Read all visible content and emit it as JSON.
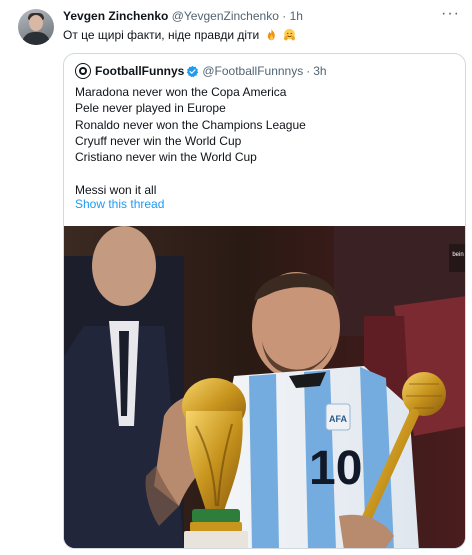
{
  "tweet": {
    "author_name": "Yevgen Zinchenko",
    "author_handle": "@YevgenZinchenko",
    "separator": "·",
    "time": "1h",
    "more_label": "···",
    "text": "От це щирі факти, ніде правди діти",
    "emojis": [
      "fire",
      "smiling-face-with-hands"
    ]
  },
  "quote": {
    "author_name": "FootballFunnys",
    "author_handle": "@FootballFunnnys",
    "separator": "·",
    "time": "3h",
    "lines": [
      "Maradona never won the Copa America",
      "Pele never played in Europe",
      "Ronaldo never won the Champions League",
      "Cryuff never win the World Cup",
      "Cristiano never win the World Cup",
      "",
      "Messi won it all"
    ],
    "show_thread": "Show this thread",
    "photo": {
      "jersey_number": "10",
      "watermark": "bein"
    }
  },
  "colors": {
    "text": "#0f1419",
    "secondary": "#536471",
    "link": "#1d9bf0",
    "border": "#cfd9de"
  }
}
